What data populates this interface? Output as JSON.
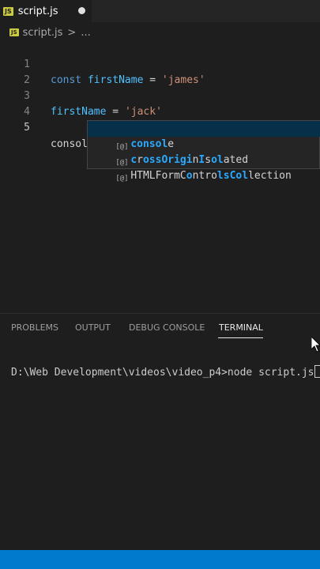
{
  "tab": {
    "badge": "JS",
    "label": "script.js",
    "dirty_icon": "dot-icon"
  },
  "breadcrumb": {
    "badge": "JS",
    "file": "script.js",
    "separator": ">",
    "more": "..."
  },
  "editor": {
    "lines": [
      {
        "number": "1",
        "tokens": {
          "keyword": "const",
          "variable": "firstName",
          "op": "=",
          "string": "'james'"
        }
      },
      {
        "number": "2"
      },
      {
        "number": "3",
        "tokens": {
          "variable": "firstName",
          "op": "=",
          "string": "'jack'"
        }
      },
      {
        "number": "4"
      },
      {
        "number": "5",
        "text": "consol"
      }
    ]
  },
  "suggestions": [
    {
      "icon": "variable-icon",
      "parts": [
        "",
        "consol",
        "e"
      ],
      "selected": true
    },
    {
      "icon": "variable-icon",
      "parts": [
        "c",
        "r",
        "ossOrigi",
        "n",
        "I",
        "s",
        "o",
        "l",
        "ated"
      ]
    },
    {
      "icon": "variable-icon",
      "parts": [
        "HTMLFormC",
        "o",
        "ntro",
        "l",
        "s",
        "C",
        "o",
        "l",
        "lection"
      ]
    }
  ],
  "panel": {
    "tabs": [
      "PROBLEMS",
      "OUTPUT",
      "DEBUG CONSOLE",
      "TERMINAL"
    ],
    "active_tab": "TERMINAL"
  },
  "terminal": {
    "line": "D:\\Web Development\\videos\\video_p4>node script.js"
  },
  "colors": {
    "accent": "#007acc",
    "selection": "#062f4a",
    "keyword": "#569cd6",
    "variable": "#4fc1ff",
    "string": "#ce9178"
  }
}
